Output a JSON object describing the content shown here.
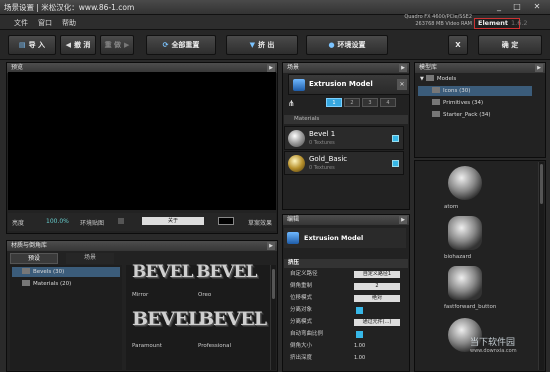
{
  "window": {
    "title": "场景设置",
    "subtitle": "米松汉化：www.86-1.com",
    "min": "_",
    "max": "□",
    "close": "✕"
  },
  "menu": [
    "文件",
    "窗口",
    "帮助"
  ],
  "gpu": {
    "line1": "Quadro FX 4600/PCIe/SSE2",
    "line2": "263768 MB Video RAM"
  },
  "element": {
    "name": "Element",
    "version": "1.6.2"
  },
  "toolbar": {
    "import": "导 入",
    "undo": "撤 消",
    "redo": "重 做",
    "reset_all": "全部重置",
    "extrude": "挤 出",
    "env": "环境设置",
    "x": "X",
    "ok": "确 定"
  },
  "preview": {
    "header": "预览",
    "brightness_label": "亮度",
    "brightness_value": "100.0%",
    "env_label": "环境贴图",
    "select_value": "关于",
    "right_label": "草案效果"
  },
  "scene": {
    "header": "场景",
    "model_name": "Extrusion Model",
    "tabs": [
      "1",
      "2",
      "3",
      "4"
    ],
    "materials_header": "Materials",
    "materials": [
      {
        "name": "Bevel 1",
        "textures": "0 Textures"
      },
      {
        "name": "Gold_Basic",
        "textures": "0 Textures"
      }
    ]
  },
  "edit": {
    "header": "编辑",
    "model_name": "Extrusion Model",
    "section": "挤压",
    "props": [
      {
        "key": "自定义路径",
        "value": "自定义路径1",
        "kind": "field"
      },
      {
        "key": "倒角重制",
        "value": "2",
        "kind": "field"
      },
      {
        "key": "位移模式",
        "value": "绝对",
        "kind": "field"
      },
      {
        "key": "分离对象",
        "value": "",
        "kind": "check"
      },
      {
        "key": "分离模式",
        "value": "通过元件(...)",
        "kind": "field"
      },
      {
        "key": "自动弯曲比例",
        "value": "",
        "kind": "check"
      },
      {
        "key": "倒角大小",
        "value": "1.00",
        "kind": "text"
      },
      {
        "key": "挤出深度",
        "value": "1.00",
        "kind": "text"
      }
    ]
  },
  "browser": {
    "header": "材质与倒角库",
    "tabs": [
      "预设",
      "场景"
    ],
    "tree": [
      {
        "label": "Bevels (30)",
        "selected": true
      },
      {
        "label": "Materials (20)",
        "selected": false
      }
    ],
    "thumbs": [
      "",
      "",
      "Mirror",
      "Oreo",
      "Paramount",
      "Professional"
    ]
  },
  "models": {
    "header": "模型库",
    "root": "Models",
    "tree": [
      {
        "label": "Icons (30)",
        "selected": true
      },
      {
        "label": "Primitives (34)",
        "selected": false
      },
      {
        "label": "Starter_Pack (34)",
        "selected": false
      }
    ],
    "items": [
      "atom",
      "biohazard",
      "fastforward_button",
      ""
    ]
  },
  "watermark": {
    "text": "当下软件园",
    "url": "www.downxia.com"
  },
  "colors": {
    "accent": "#37a8e0",
    "selection": "#3b5c7a"
  }
}
